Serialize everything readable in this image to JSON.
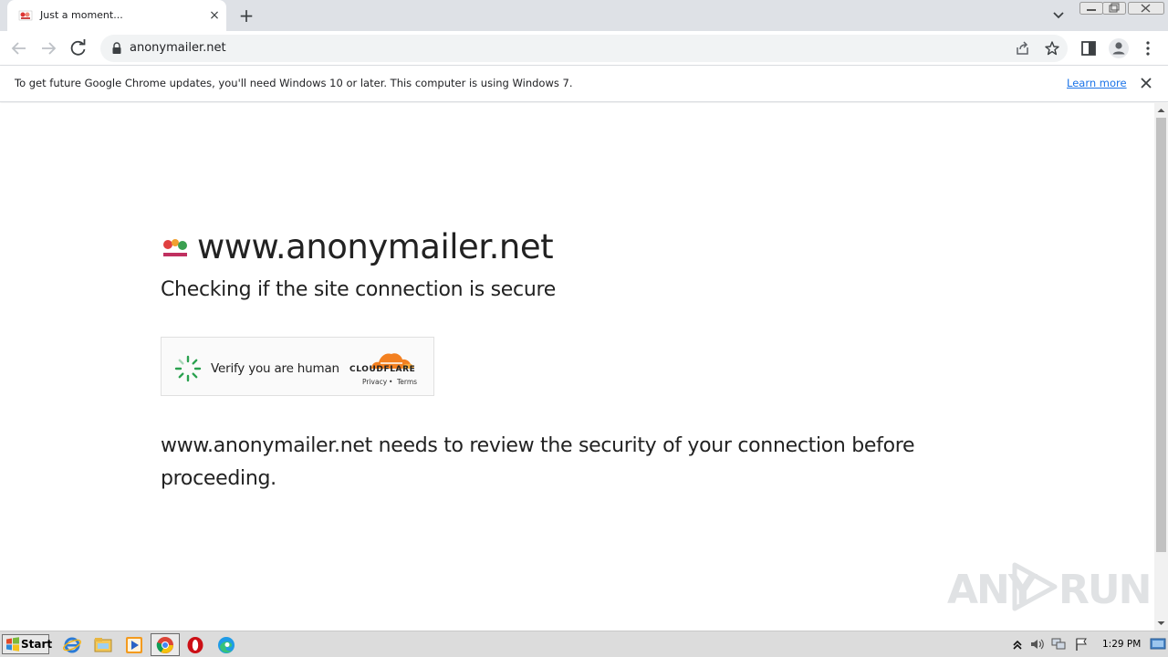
{
  "browser": {
    "tab": {
      "title": "Just a moment...",
      "close_glyph": "×"
    },
    "new_tab_glyph": "+",
    "address": {
      "url": "anonymailer.net"
    }
  },
  "infobar": {
    "message": "To get future Google Chrome updates, you'll need Windows 10 or later. This computer is using Windows 7.",
    "link": "Learn more"
  },
  "page": {
    "site_title": "www.anonymailer.net",
    "subtitle": "Checking if the site connection is secure",
    "challenge": {
      "label": "Verify you are human",
      "brand": "CLOUDFLARE",
      "privacy": "Privacy",
      "separator": "•",
      "terms": "Terms"
    },
    "review_text": "www.anonymailer.net needs to review the security of your connection before proceeding."
  },
  "watermark": {
    "left": "ANY",
    "right": "RUN"
  },
  "taskbar": {
    "start_label": "Start",
    "clock": "1:29 PM",
    "pinned": [
      "internet-explorer-icon",
      "file-explorer-icon",
      "media-player-icon",
      "chrome-icon",
      "opera-icon",
      "edge-icon"
    ]
  },
  "colors": {
    "cloudflare_orange": "#f38020",
    "link_blue": "#1a73e8",
    "spinner_green": "#2aa14f"
  }
}
